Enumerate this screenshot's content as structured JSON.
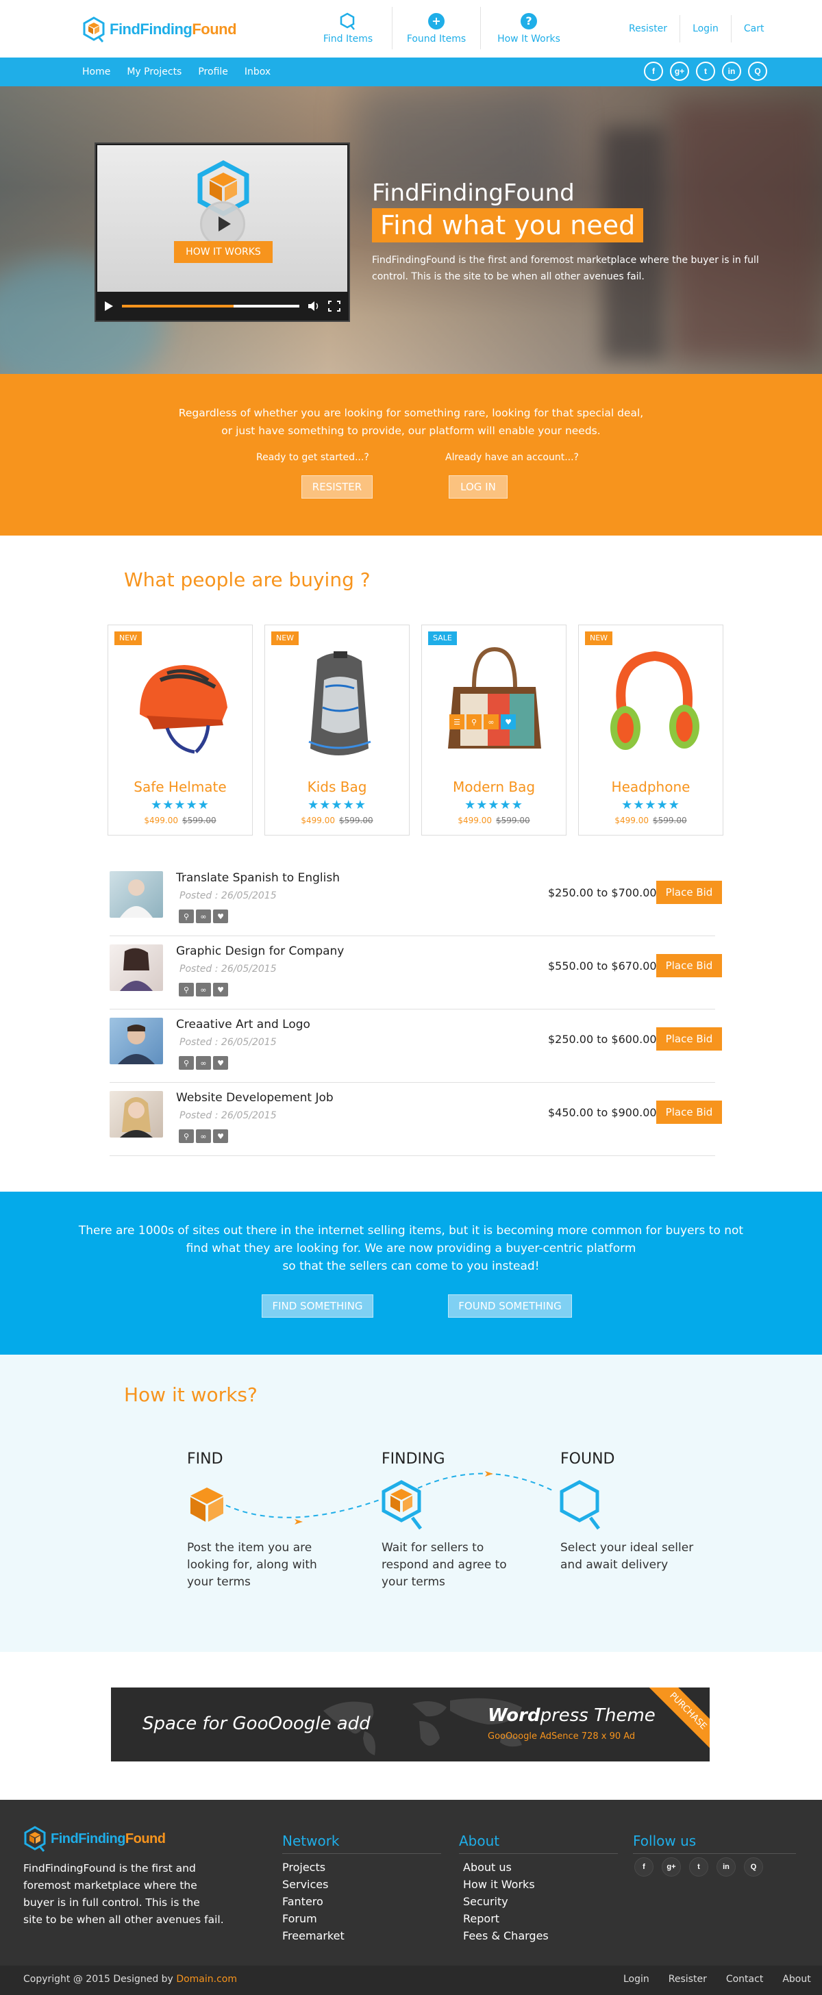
{
  "header": {
    "logo_left": "FindFinding",
    "logo_right": "Found",
    "nav": [
      {
        "label": "Find Items",
        "icon": "search-icon"
      },
      {
        "label": "Found Items",
        "icon": "plus-icon",
        "glyph": "+"
      },
      {
        "label": "How It Works",
        "icon": "question-icon",
        "glyph": "?"
      }
    ],
    "user_links": [
      "Resister",
      "Login",
      "Cart"
    ]
  },
  "subnav": {
    "items": [
      "Home",
      "My Projects",
      "Profile",
      "Inbox"
    ],
    "social": [
      "f",
      "g+",
      "t",
      "in",
      "Q"
    ]
  },
  "hero": {
    "video_button": "HOW IT WORKS",
    "video_progress": 0.63,
    "title": "FindFindingFound",
    "tagline": "Find what you need",
    "description": "FindFindingFound is the first and foremost marketplace where the buyer is in full control. This is the site to be when all other avenues fail."
  },
  "intro": {
    "line1": "Regardless of whether you are looking for something rare, looking for that special deal,",
    "line2": "or just have something to provide, our platform will enable your needs.",
    "question_register": "Ready to get started...?",
    "question_login": "Already have an account...?",
    "register_button": "RESISTER",
    "login_button": "LOG IN"
  },
  "buying": {
    "heading": "What people are buying ?",
    "products": [
      {
        "badge": "NEW",
        "badge_color": "#f7941d",
        "name": "Safe Helmate",
        "stars": "★★★★★",
        "price": "$499.00",
        "old_price": "$599.00"
      },
      {
        "badge": "NEW",
        "badge_color": "#f7941d",
        "name": "Kids Bag",
        "stars": "★★★★★",
        "price": "$499.00",
        "old_price": "$599.00"
      },
      {
        "badge": "SALE",
        "badge_color": "#1faee8",
        "name": "Modern Bag",
        "stars": "★★★★★",
        "price": "$499.00",
        "old_price": "$599.00"
      },
      {
        "badge": "NEW",
        "badge_color": "#f7941d",
        "name": "Headphone",
        "stars": "★★★★★",
        "price": "$499.00",
        "old_price": "$599.00"
      }
    ]
  },
  "jobs": [
    {
      "title": "Translate Spanish to English",
      "posted": "Posted : 26/05/2015",
      "range": "$250.00 to $700.00",
      "button": "Place Bid"
    },
    {
      "title": "Graphic Design for Company",
      "posted": "Posted : 26/05/2015",
      "range": "$550.00 to $670.00",
      "button": "Place Bid"
    },
    {
      "title": "Creaative Art and Logo",
      "posted": "Posted : 26/05/2015",
      "range": "$250.00 to $600.00",
      "button": "Place Bid"
    },
    {
      "title": "Website Developement Job",
      "posted": "Posted : 26/05/2015",
      "range": "$450.00 to $900.00",
      "button": "Place Bid"
    }
  ],
  "band": {
    "line1": "There are 1000s of sites out there in the internet selling items, but it is becoming more common for buyers to not",
    "line2": "find what they are looking for. We are now providing a buyer-centric platform",
    "line3": "so that the sellers can come to you instead!",
    "find_button": "FIND SOMETHING",
    "found_button": "FOUND SOMETHING"
  },
  "how": {
    "heading": "How it works?",
    "steps": [
      {
        "title": "FIND",
        "text1": "Post the item you are",
        "text2": "looking for, along with",
        "text3": "your terms"
      },
      {
        "title": "FINDING",
        "text1": "Wait for sellers to",
        "text2": "respond and agree to",
        "text3": "your terms"
      },
      {
        "title": "FOUND",
        "text1": "Select your ideal seller",
        "text2": "and await delivery",
        "text3": ""
      }
    ]
  },
  "ad": {
    "left": "Space for GooOoogle add",
    "brand_bold": "Word",
    "brand_rest": "press Theme",
    "sub": "GooOoogle AdSence 728 x 90 Ad",
    "ribbon": "PURCHASE"
  },
  "footer": {
    "logo_left": "FindFinding",
    "logo_right": "Found",
    "desc1": "FindFindingFound is the first and",
    "desc2": "foremost marketplace where the",
    "desc3": "buyer is in full control. This is the",
    "desc4": "site to be when all other avenues fail.",
    "network_heading": "Network",
    "network": [
      "Projects",
      "Services",
      "Fantero",
      "Forum",
      "Freemarket"
    ],
    "about_heading": "About",
    "about": [
      "About us",
      "How it Works",
      "Security",
      "Report",
      "Fees & Charges"
    ],
    "follow_heading": "Follow us",
    "social": [
      "f",
      "g+",
      "t",
      "in",
      "Q"
    ],
    "copyright": "Copyright @ 2015 Designed by",
    "copyright_link": "Domain.com",
    "bottom_links": [
      "Login",
      "Resister",
      "Contact",
      "About"
    ]
  }
}
